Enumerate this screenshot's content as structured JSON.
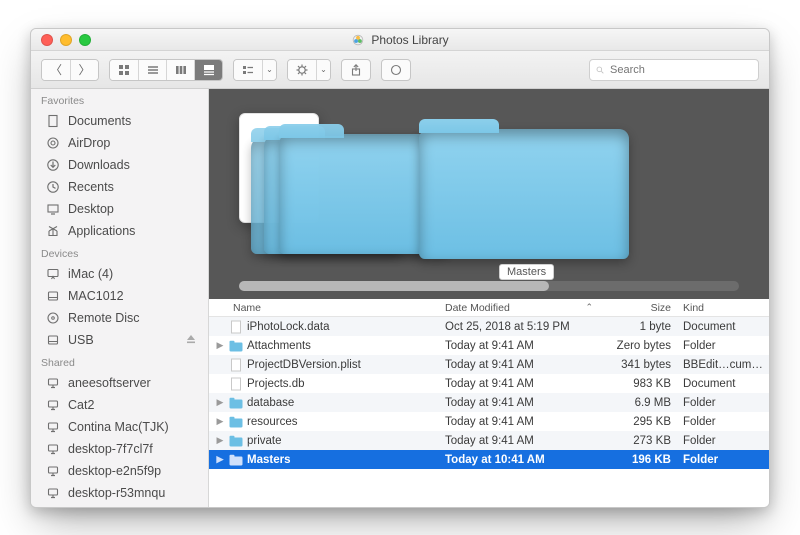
{
  "window": {
    "title": "Photos Library"
  },
  "toolbar": {
    "search_placeholder": "Search"
  },
  "preview": {
    "center_label": "Masters"
  },
  "sidebar": {
    "groups": [
      {
        "header": "Favorites",
        "items": [
          {
            "icon": "doc",
            "label": "Documents"
          },
          {
            "icon": "airdrop",
            "label": "AirDrop"
          },
          {
            "icon": "download",
            "label": "Downloads"
          },
          {
            "icon": "clock",
            "label": "Recents"
          },
          {
            "icon": "desktop",
            "label": "Desktop"
          },
          {
            "icon": "apps",
            "label": "Applications"
          }
        ]
      },
      {
        "header": "Devices",
        "items": [
          {
            "icon": "imac",
            "label": "iMac (4)"
          },
          {
            "icon": "disk",
            "label": "MAC1012"
          },
          {
            "icon": "disc",
            "label": "Remote Disc"
          },
          {
            "icon": "disk",
            "label": "USB",
            "eject": true
          }
        ]
      },
      {
        "header": "Shared",
        "items": [
          {
            "icon": "net",
            "label": "aneesoftserver"
          },
          {
            "icon": "net",
            "label": "Cat2"
          },
          {
            "icon": "net",
            "label": "Contina Mac(TJK)"
          },
          {
            "icon": "net",
            "label": "desktop-7f7cl7f"
          },
          {
            "icon": "net",
            "label": "desktop-e2n5f9p"
          },
          {
            "icon": "net",
            "label": "desktop-r53mnqu"
          }
        ]
      }
    ]
  },
  "columns": {
    "name": "Name",
    "date": "Date Modified",
    "size": "Size",
    "kind": "Kind",
    "sort_dir": "asc"
  },
  "rows": [
    {
      "expander": "",
      "icon": "doc",
      "name": "iPhotoLock.data",
      "date": "Oct 25, 2018 at 5:19 PM",
      "size": "1 byte",
      "kind": "Document"
    },
    {
      "expander": "▶",
      "icon": "folder",
      "name": "Attachments",
      "date": "Today at 9:41 AM",
      "size": "Zero bytes",
      "kind": "Folder"
    },
    {
      "expander": "",
      "icon": "doc",
      "name": "ProjectDBVersion.plist",
      "date": "Today at 9:41 AM",
      "size": "341 bytes",
      "kind": "BBEdit…cument"
    },
    {
      "expander": "",
      "icon": "doc",
      "name": "Projects.db",
      "date": "Today at 9:41 AM",
      "size": "983 KB",
      "kind": "Document"
    },
    {
      "expander": "▶",
      "icon": "folder",
      "name": "database",
      "date": "Today at 9:41 AM",
      "size": "6.9 MB",
      "kind": "Folder"
    },
    {
      "expander": "▶",
      "icon": "folder",
      "name": "resources",
      "date": "Today at 9:41 AM",
      "size": "295 KB",
      "kind": "Folder"
    },
    {
      "expander": "▶",
      "icon": "folder",
      "name": "private",
      "date": "Today at 9:41 AM",
      "size": "273 KB",
      "kind": "Folder"
    },
    {
      "expander": "▶",
      "icon": "folder",
      "name": "Masters",
      "date": "Today at 10:41 AM",
      "size": "196 KB",
      "kind": "Folder",
      "selected": true
    }
  ]
}
